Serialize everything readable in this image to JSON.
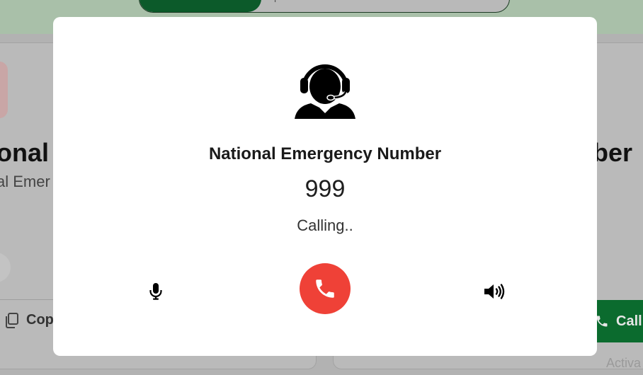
{
  "background": {
    "top_toggle": {
      "label_partial": "p"
    },
    "left_card": {
      "title_partial": "onal",
      "subtitle_partial": "al Emer",
      "copy_label_partial": "Cop"
    },
    "right_card": {
      "title_partial": "ber",
      "call_label_partial": "Call"
    },
    "watermark": "Activa"
  },
  "modal": {
    "icon": "headset-agent-icon",
    "title": "National Emergency Number",
    "number": "999",
    "status": "Calling..",
    "controls": {
      "mic_icon": "microphone-icon",
      "hangup_icon": "phone-icon",
      "speaker_icon": "speaker-volume-icon"
    }
  },
  "colors": {
    "hangup": "#EF4137",
    "brand_green": "#0B6B2E",
    "overlay": "#B2B2B2"
  }
}
